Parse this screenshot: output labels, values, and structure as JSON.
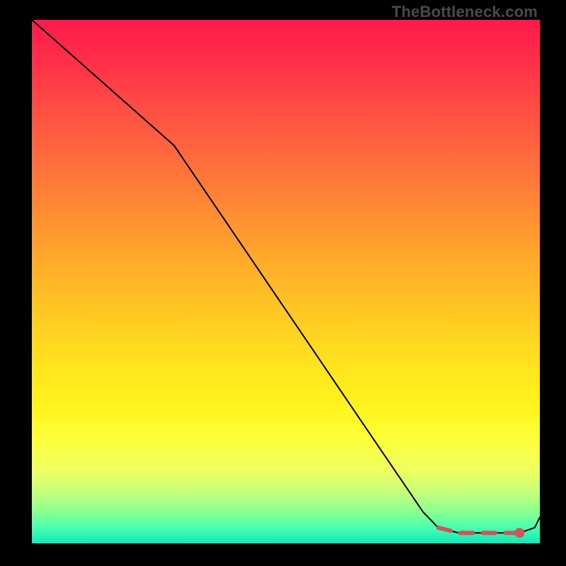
{
  "watermark": "TheBottleneck.com",
  "chart_data": {
    "type": "line",
    "title": "",
    "xlabel": "",
    "ylabel": "",
    "xlim": [
      0,
      100
    ],
    "ylim": [
      0,
      100
    ],
    "grid": false,
    "series": [
      {
        "name": "curve",
        "x": [
          0,
          7,
          14,
          21,
          28,
          35,
          42,
          49,
          56,
          63,
          70,
          77,
          80,
          84,
          88,
          92,
          96,
          99,
          100
        ],
        "values": [
          100,
          94,
          88,
          82,
          76,
          66,
          56,
          46,
          36,
          26,
          16,
          6,
          3,
          2,
          2,
          2,
          2,
          3,
          5
        ]
      }
    ],
    "highlight": {
      "name": "valley-highlight",
      "x": [
        80,
        84,
        88,
        92,
        96
      ],
      "values": [
        3,
        2,
        2,
        2,
        2
      ]
    },
    "marker": {
      "name": "end-dot",
      "x": 96,
      "value": 2
    }
  }
}
